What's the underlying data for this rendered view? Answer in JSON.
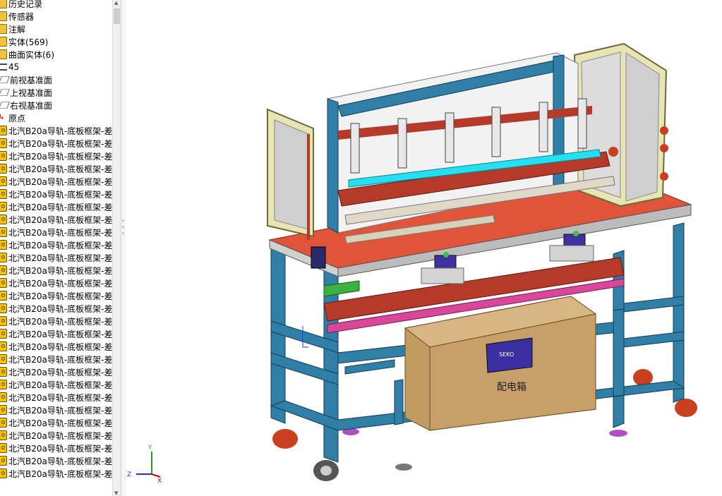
{
  "feature_tree": {
    "items": [
      {
        "icon": "history-icon",
        "label": "历史记录"
      },
      {
        "icon": "sensor-icon",
        "label": "传感器"
      },
      {
        "icon": "annotation-icon",
        "label": "注解"
      },
      {
        "icon": "solid-bodies-folder-icon",
        "label": "实体(569)"
      },
      {
        "icon": "surface-bodies-folder-icon",
        "label": "曲面实体(6)"
      },
      {
        "icon": "material-icon",
        "label": "45"
      },
      {
        "icon": "plane-icon",
        "label": "前视基准面"
      },
      {
        "icon": "plane-icon",
        "label": "上视基准面"
      },
      {
        "icon": "plane-icon",
        "label": "右视基准面"
      },
      {
        "icon": "origin-icon",
        "label": "原点"
      },
      {
        "icon": "part-icon",
        "label": "北汽B20a导轨-底板框架-差"
      },
      {
        "icon": "part-icon",
        "label": "北汽B20a导轨-底板框架-差"
      },
      {
        "icon": "part-icon",
        "label": "北汽B20a导轨-底板框架-差"
      },
      {
        "icon": "part-icon",
        "label": "北汽B20a导轨-底板框架-差"
      },
      {
        "icon": "part-icon",
        "label": "北汽B20a导轨-底板框架-差"
      },
      {
        "icon": "part-icon",
        "label": "北汽B20a导轨-底板框架-差"
      },
      {
        "icon": "part-icon",
        "label": "北汽B20a导轨-底板框架-差"
      },
      {
        "icon": "part-icon",
        "label": "北汽B20a导轨-底板框架-差"
      },
      {
        "icon": "part-icon",
        "label": "北汽B20a导轨-底板框架-差"
      },
      {
        "icon": "part-icon",
        "label": "北汽B20a导轨-底板框架-差"
      },
      {
        "icon": "part-icon",
        "label": "北汽B20a导轨-底板框架-差"
      },
      {
        "icon": "part-icon",
        "label": "北汽B20a导轨-底板框架-差"
      },
      {
        "icon": "part-icon",
        "label": "北汽B20a导轨-底板框架-差"
      },
      {
        "icon": "part-icon",
        "label": "北汽B20a导轨-底板框架-差"
      },
      {
        "icon": "part-icon",
        "label": "北汽B20a导轨-底板框架-差"
      },
      {
        "icon": "part-icon",
        "label": "北汽B20a导轨-底板框架-差"
      },
      {
        "icon": "part-icon",
        "label": "北汽B20a导轨-底板框架-差"
      },
      {
        "icon": "part-icon",
        "label": "北汽B20a导轨-底板框架-差"
      },
      {
        "icon": "part-icon",
        "label": "北汽B20a导轨-底板框架-差"
      },
      {
        "icon": "part-icon",
        "label": "北汽B20a导轨-底板框架-差"
      },
      {
        "icon": "part-icon",
        "label": "北汽B20a导轨-底板框架-差"
      },
      {
        "icon": "part-icon",
        "label": "北汽B20a导轨-底板框架-差"
      },
      {
        "icon": "part-icon",
        "label": "北汽B20a导轨-底板框架-差"
      },
      {
        "icon": "part-icon",
        "label": "北汽B20a导轨-底板框架-差"
      },
      {
        "icon": "part-icon",
        "label": "北汽B20a导轨-底板框架-差"
      },
      {
        "icon": "part-icon",
        "label": "北汽B20a导轨-底板框架-差"
      },
      {
        "icon": "part-icon",
        "label": "北汽B20a导轨-底板框架-差"
      },
      {
        "icon": "part-icon",
        "label": "北汽B20a导轨-底板框架-差"
      }
    ]
  },
  "model": {
    "box_label": "配电箱",
    "box_nameplate": "SEKO"
  },
  "triad": {
    "x": "X",
    "y": "Y",
    "z": "Z"
  },
  "colors": {
    "frame": "#2f7fa6",
    "table_top": "#e0553a",
    "box": "#c49a63",
    "guard": "#e8e4b4",
    "rail": "#b53a2a",
    "highlight": "#25e0f0"
  }
}
